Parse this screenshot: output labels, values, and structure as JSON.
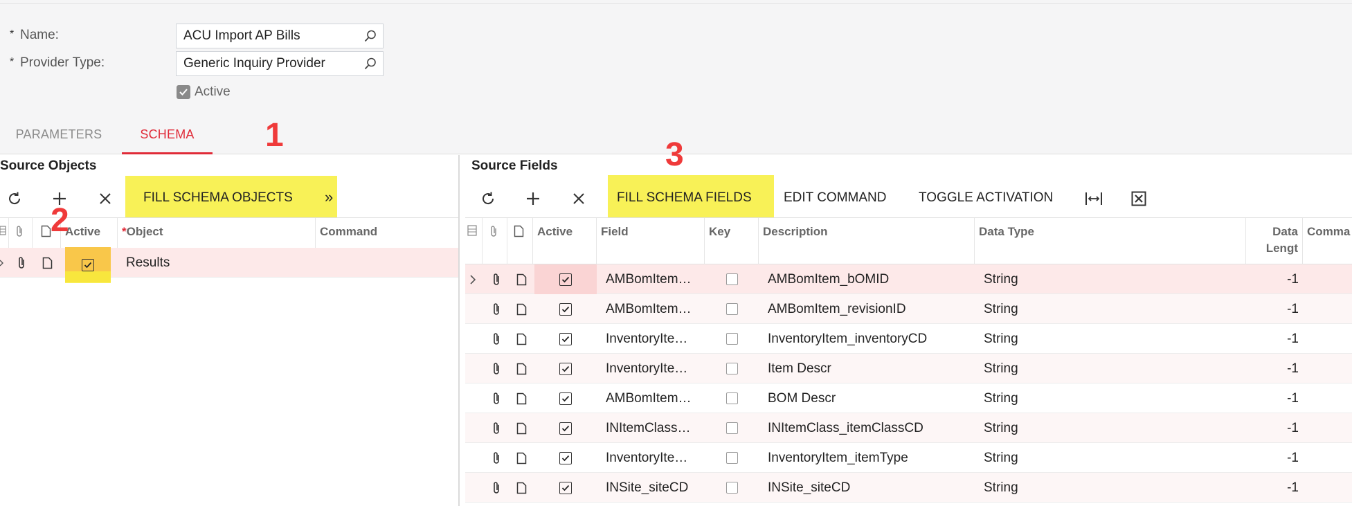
{
  "form": {
    "name_label": "Name:",
    "name_value": "ACU Import AP Bills",
    "provider_label": "Provider Type:",
    "provider_value": "Generic Inquiry Provider",
    "required_mark": "*",
    "active_label": "Active"
  },
  "tabs": [
    {
      "label": "PARAMETERS"
    },
    {
      "label": "SCHEMA"
    }
  ],
  "annotations": [
    "1",
    "2",
    "3"
  ],
  "source_objects": {
    "title": "Source Objects",
    "toolbar": {
      "fill_label": "FILL SCHEMA OBJECTS",
      "more_label": "»"
    },
    "headers": {
      "active": "Active",
      "object": "Object",
      "command": "Command",
      "required_mark": "*"
    },
    "row": {
      "object": "Results",
      "command": ""
    }
  },
  "source_fields": {
    "title": "Source Fields",
    "toolbar": {
      "fill_label": "FILL SCHEMA FIELDS",
      "edit_label": "EDIT COMMAND",
      "toggle_label": "TOGGLE ACTIVATION"
    },
    "headers": {
      "active": "Active",
      "field": "Field",
      "key": "Key",
      "description": "Description",
      "data_type": "Data Type",
      "data_length_1": "Data",
      "data_length_2": "Lengt",
      "command": "Comma"
    },
    "rows": [
      {
        "field": "AMBomItem…",
        "description": "AMBomItem_bOMID",
        "data_type": "String",
        "length": "-1"
      },
      {
        "field": "AMBomItem…",
        "description": "AMBomItem_revisionID",
        "data_type": "String",
        "length": "-1"
      },
      {
        "field": "InventoryIte…",
        "description": "InventoryItem_inventoryCD",
        "data_type": "String",
        "length": "-1"
      },
      {
        "field": "InventoryIte…",
        "description": "Item Descr",
        "data_type": "String",
        "length": "-1"
      },
      {
        "field": "AMBomItem…",
        "description": "BOM Descr",
        "data_type": "String",
        "length": "-1"
      },
      {
        "field": "INItemClass…",
        "description": "INItemClass_itemClassCD",
        "data_type": "String",
        "length": "-1"
      },
      {
        "field": "InventoryIte…",
        "description": "InventoryItem_itemType",
        "data_type": "String",
        "length": "-1"
      },
      {
        "field": "INSite_siteCD",
        "description": "INSite_siteCD",
        "data_type": "String",
        "length": "-1"
      }
    ]
  },
  "colors": {
    "accent": "#e02b38",
    "highlight": "#f7ee3a",
    "annotation": "#ef3a3a",
    "selected_row": "#fde9e9",
    "active_cell_highlight": "#f9c74a"
  }
}
